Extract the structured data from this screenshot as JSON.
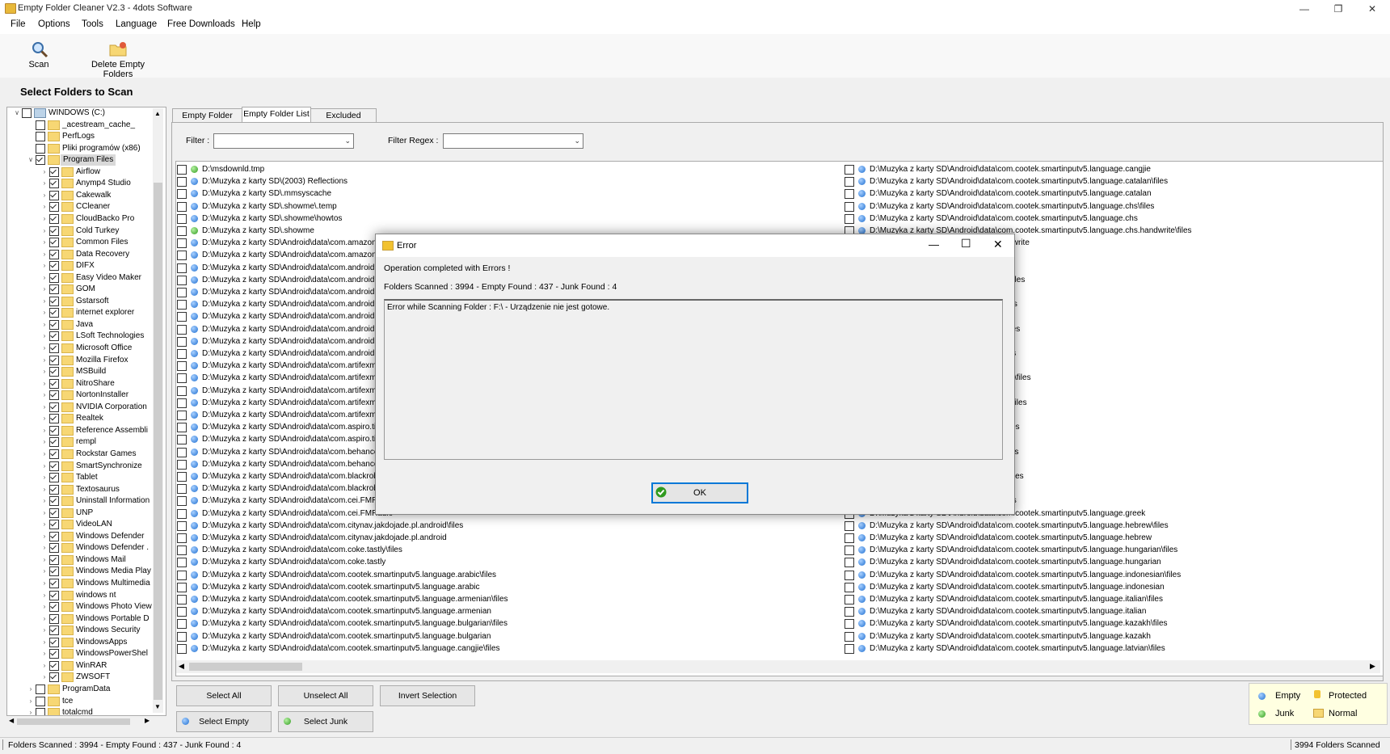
{
  "window": {
    "title": "Empty Folder Cleaner V2.3 - 4dots Software"
  },
  "menu": [
    "File",
    "Options",
    "Tools",
    "Language",
    "Free Downloads",
    "Help"
  ],
  "toolbar": {
    "scan_label": "Scan",
    "delete_label": "Delete Empty Folders"
  },
  "heading": "Select Folders to Scan",
  "tree": {
    "root": "WINDOWS (C:)",
    "top_items": [
      "_acestream_cache_",
      "PerfLogs",
      "Pliki programów (x86)"
    ],
    "program_files": "Program Files",
    "children": [
      "Airflow",
      "Anymp4 Studio",
      "Cakewalk",
      "CCleaner",
      "CloudBacko Pro",
      "Cold Turkey",
      "Common Files",
      "Data Recovery",
      "DIFX",
      "Easy Video Maker",
      "GOM",
      "Gstarsoft",
      "internet explorer",
      "Java",
      "LSoft Technologies",
      "Microsoft Office",
      "Mozilla Firefox",
      "MSBuild",
      "NitroShare",
      "NortonInstaller",
      "NVIDIA Corporation",
      "Realtek",
      "Reference Assembli",
      "rempl",
      "Rockstar Games",
      "SmartSynchronize",
      "Tablet",
      "Textosaurus",
      "Uninstall Information",
      "UNP",
      "VideoLAN",
      "Windows Defender",
      "Windows Defender .",
      "Windows Mail",
      "Windows Media Play",
      "Windows Multimedia",
      "windows nt",
      "Windows Photo View",
      "Windows Portable D",
      "Windows Security",
      "WindowsApps",
      "WindowsPowerShel",
      "WinRAR",
      "ZWSOFT"
    ],
    "bottom_items": [
      "ProgramData",
      "tce",
      "totalcmd",
      "USBCaptureSvc"
    ]
  },
  "tabs": [
    "Empty Folder Tree",
    "Empty Folder List",
    "Excluded Folders"
  ],
  "filter": {
    "filter_label": "Filter :",
    "regex_label": "Filter Regex :",
    "filter_value": "",
    "regex_value": ""
  },
  "list_left": [
    {
      "t": "D:\\msdownld.tmp",
      "c": "green"
    },
    {
      "t": "D:\\Muzyka z karty SD\\(2003) Reflections",
      "c": "blue"
    },
    {
      "t": "D:\\Muzyka z karty SD\\.mmsyscache",
      "c": "blue"
    },
    {
      "t": "D:\\Muzyka z karty SD\\.showme\\.temp",
      "c": "blue"
    },
    {
      "t": "D:\\Muzyka z karty SD\\.showme\\howtos",
      "c": "blue"
    },
    {
      "t": "D:\\Muzyka z karty SD\\.showme",
      "c": "green"
    },
    {
      "t": "D:\\Muzyka z karty SD\\Android\\data\\com.amazon.",
      "c": "blue"
    },
    {
      "t": "D:\\Muzyka z karty SD\\Android\\data\\com.amazon.",
      "c": "blue"
    },
    {
      "t": "D:\\Muzyka z karty SD\\Android\\data\\com.android.l",
      "c": "blue"
    },
    {
      "t": "D:\\Muzyka z karty SD\\Android\\data\\com.android.l",
      "c": "blue"
    },
    {
      "t": "D:\\Muzyka z karty SD\\Android\\data\\com.android.",
      "c": "blue"
    },
    {
      "t": "D:\\Muzyka z karty SD\\Android\\data\\com.android.",
      "c": "blue"
    },
    {
      "t": "D:\\Muzyka z karty SD\\Android\\data\\com.android.p",
      "c": "blue"
    },
    {
      "t": "D:\\Muzyka z karty SD\\Android\\data\\com.android.p",
      "c": "blue"
    },
    {
      "t": "D:\\Muzyka z karty SD\\Android\\data\\com.android.s",
      "c": "blue"
    },
    {
      "t": "D:\\Muzyka z karty SD\\Android\\data\\com.android.s",
      "c": "blue"
    },
    {
      "t": "D:\\Muzyka z karty SD\\Android\\data\\com.artifexmu",
      "c": "blue"
    },
    {
      "t": "D:\\Muzyka z karty SD\\Android\\data\\com.artifexmu",
      "c": "blue"
    },
    {
      "t": "D:\\Muzyka z karty SD\\Android\\data\\com.artifexmu",
      "c": "blue"
    },
    {
      "t": "D:\\Muzyka z karty SD\\Android\\data\\com.artifexmu",
      "c": "blue"
    },
    {
      "t": "D:\\Muzyka z karty SD\\Android\\data\\com.artifexmu",
      "c": "blue"
    },
    {
      "t": "D:\\Muzyka z karty SD\\Android\\data\\com.aspiro.tid",
      "c": "blue"
    },
    {
      "t": "D:\\Muzyka z karty SD\\Android\\data\\com.aspiro.tid",
      "c": "blue"
    },
    {
      "t": "D:\\Muzyka z karty SD\\Android\\data\\com.behance",
      "c": "blue"
    },
    {
      "t": "D:\\Muzyka z karty SD\\Android\\data\\com.behance",
      "c": "blue"
    },
    {
      "t": "D:\\Muzyka z karty SD\\Android\\data\\com.blackrob",
      "c": "blue"
    },
    {
      "t": "D:\\Muzyka z karty SD\\Android\\data\\com.blackrob",
      "c": "blue"
    },
    {
      "t": "D:\\Muzyka z karty SD\\Android\\data\\com.cei.FMR",
      "c": "blue"
    },
    {
      "t": "D:\\Muzyka z karty SD\\Android\\data\\com.cei.FMRadio",
      "c": "blue"
    },
    {
      "t": "D:\\Muzyka z karty SD\\Android\\data\\com.citynav.jakdojade.pl.android\\files",
      "c": "blue"
    },
    {
      "t": "D:\\Muzyka z karty SD\\Android\\data\\com.citynav.jakdojade.pl.android",
      "c": "blue"
    },
    {
      "t": "D:\\Muzyka z karty SD\\Android\\data\\com.coke.tastly\\files",
      "c": "blue"
    },
    {
      "t": "D:\\Muzyka z karty SD\\Android\\data\\com.coke.tastly",
      "c": "blue"
    },
    {
      "t": "D:\\Muzyka z karty SD\\Android\\data\\com.cootek.smartinputv5.language.arabic\\files",
      "c": "blue"
    },
    {
      "t": "D:\\Muzyka z karty SD\\Android\\data\\com.cootek.smartinputv5.language.arabic",
      "c": "blue"
    },
    {
      "t": "D:\\Muzyka z karty SD\\Android\\data\\com.cootek.smartinputv5.language.armenian\\files",
      "c": "blue"
    },
    {
      "t": "D:\\Muzyka z karty SD\\Android\\data\\com.cootek.smartinputv5.language.armenian",
      "c": "blue"
    },
    {
      "t": "D:\\Muzyka z karty SD\\Android\\data\\com.cootek.smartinputv5.language.bulgarian\\files",
      "c": "blue"
    },
    {
      "t": "D:\\Muzyka z karty SD\\Android\\data\\com.cootek.smartinputv5.language.bulgarian",
      "c": "blue"
    },
    {
      "t": "D:\\Muzyka z karty SD\\Android\\data\\com.cootek.smartinputv5.language.cangjie\\files",
      "c": "blue"
    }
  ],
  "list_right": [
    {
      "t": "D:\\Muzyka z karty SD\\Android\\data\\com.cootek.smartinputv5.language.cangjie",
      "c": "blue"
    },
    {
      "t": "D:\\Muzyka z karty SD\\Android\\data\\com.cootek.smartinputv5.language.catalan\\files",
      "c": "blue"
    },
    {
      "t": "D:\\Muzyka z karty SD\\Android\\data\\com.cootek.smartinputv5.language.catalan",
      "c": "blue"
    },
    {
      "t": "D:\\Muzyka z karty SD\\Android\\data\\com.cootek.smartinputv5.language.chs\\files",
      "c": "blue"
    },
    {
      "t": "D:\\Muzyka z karty SD\\Android\\data\\com.cootek.smartinputv5.language.chs",
      "c": "blue"
    },
    {
      "t": "D:\\Muzyka z karty SD\\Android\\data\\com.cootek.smartinputv5.language.chs.handwrite\\files",
      "c": "blue"
    },
    {
      "t": "cootek.smartinputv5.language.chs.handwrite",
      "c": "blue"
    },
    {
      "t": "cootek.smartinputv5.language.cht\\files",
      "c": "blue"
    },
    {
      "t": "cootek.smartinputv5.language.cht",
      "c": "blue"
    },
    {
      "t": "cootek.smartinputv5.language.croatian\\files",
      "c": "blue"
    },
    {
      "t": "cootek.smartinputv5.language.croatian",
      "c": "blue"
    },
    {
      "t": "cootek.smartinputv5.language.czech\\files",
      "c": "blue"
    },
    {
      "t": "cootek.smartinputv5.language.czech",
      "c": "blue"
    },
    {
      "t": "cootek.smartinputv5.language.danish\\files",
      "c": "blue"
    },
    {
      "t": "cootek.smartinputv5.language.danish",
      "c": "blue"
    },
    {
      "t": "cootek.smartinputv5.language.dutch\\files",
      "c": "blue"
    },
    {
      "t": "cootek.smartinputv5.language.dutch",
      "c": "blue"
    },
    {
      "t": "cootek.smartinputv5.language.englishgb\\files",
      "c": "blue"
    },
    {
      "t": "cootek.smartinputv5.language.englishgb",
      "c": "blue"
    },
    {
      "t": "cootek.smartinputv5.language.estonian\\files",
      "c": "blue"
    },
    {
      "t": "cootek.smartinputv5.language.estonian",
      "c": "blue"
    },
    {
      "t": "cootek.smartinputv5.language.finnish\\files",
      "c": "blue"
    },
    {
      "t": "cootek.smartinputv5.language.finnish",
      "c": "blue"
    },
    {
      "t": "cootek.smartinputv5.language.french\\files",
      "c": "blue"
    },
    {
      "t": "cootek.smartinputv5.language.french",
      "c": "blue"
    },
    {
      "t": "cootek.smartinputv5.language.german\\files",
      "c": "blue"
    },
    {
      "t": "cootek.smartinputv5.language.german",
      "c": "blue"
    },
    {
      "t": "cootek.smartinputv5.language.greek\\files",
      "c": "blue"
    },
    {
      "t": "D:\\Muzyka z karty SD\\Android\\data\\com.cootek.smartinputv5.language.greek",
      "c": "blue"
    },
    {
      "t": "D:\\Muzyka z karty SD\\Android\\data\\com.cootek.smartinputv5.language.hebrew\\files",
      "c": "blue"
    },
    {
      "t": "D:\\Muzyka z karty SD\\Android\\data\\com.cootek.smartinputv5.language.hebrew",
      "c": "blue"
    },
    {
      "t": "D:\\Muzyka z karty SD\\Android\\data\\com.cootek.smartinputv5.language.hungarian\\files",
      "c": "blue"
    },
    {
      "t": "D:\\Muzyka z karty SD\\Android\\data\\com.cootek.smartinputv5.language.hungarian",
      "c": "blue"
    },
    {
      "t": "D:\\Muzyka z karty SD\\Android\\data\\com.cootek.smartinputv5.language.indonesian\\files",
      "c": "blue"
    },
    {
      "t": "D:\\Muzyka z karty SD\\Android\\data\\com.cootek.smartinputv5.language.indonesian",
      "c": "blue"
    },
    {
      "t": "D:\\Muzyka z karty SD\\Android\\data\\com.cootek.smartinputv5.language.italian\\files",
      "c": "blue"
    },
    {
      "t": "D:\\Muzyka z karty SD\\Android\\data\\com.cootek.smartinputv5.language.italian",
      "c": "blue"
    },
    {
      "t": "D:\\Muzyka z karty SD\\Android\\data\\com.cootek.smartinputv5.language.kazakh\\files",
      "c": "blue"
    },
    {
      "t": "D:\\Muzyka z karty SD\\Android\\data\\com.cootek.smartinputv5.language.kazakh",
      "c": "blue"
    },
    {
      "t": "D:\\Muzyka z karty SD\\Android\\data\\com.cootek.smartinputv5.language.latvian\\files",
      "c": "blue"
    }
  ],
  "buttons": {
    "select_all": "Select All",
    "unselect_all": "Unselect All",
    "invert": "Invert Selection",
    "select_empty": "Select Empty",
    "select_junk": "Select Junk"
  },
  "legend": {
    "empty": "Empty",
    "protected": "Protected",
    "junk": "Junk",
    "normal": "Normal"
  },
  "status": {
    "left": "Folders Scanned : 3994 - Empty Found : 437 - Junk Found : 4",
    "right": "3994 Folders Scanned"
  },
  "dialog": {
    "title": "Error",
    "message": "Operation completed with Errors !",
    "summary": "Folders Scanned : 3994 - Empty Found : 437 - Junk Found : 4",
    "error_text": "Error while Scanning Folder : F:\\ - Urządzenie nie jest gotowe.",
    "ok_label": "OK"
  },
  "colors": {
    "accent": "#0078d7",
    "empty_dot": "#1f6fd1",
    "junk_dot": "#2f9a1e",
    "folder": "#f7d774"
  }
}
